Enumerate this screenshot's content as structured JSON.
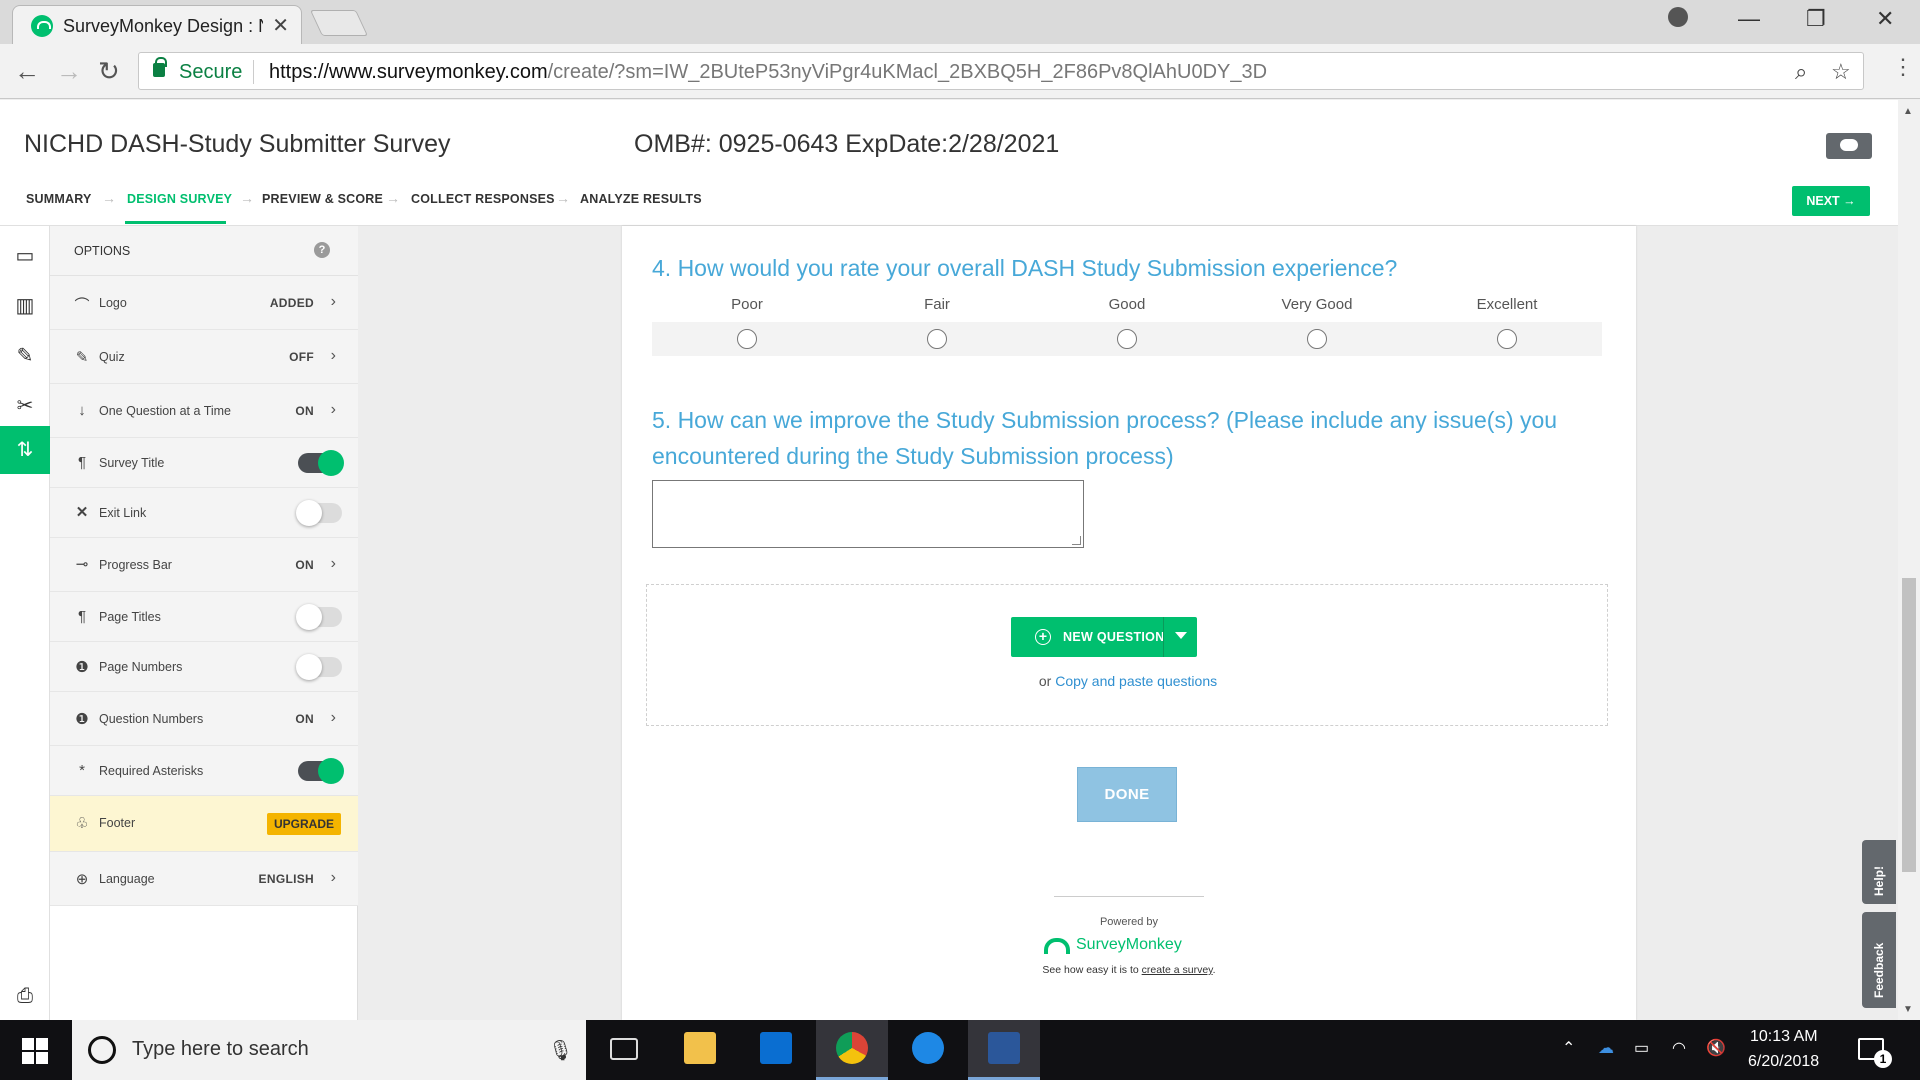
{
  "browser": {
    "tab_title": "SurveyMonkey Design : N",
    "tab_close": "✕",
    "secure_label": "Secure",
    "url_host": "https://www.surveymonkey.com",
    "url_path": "/create/?sm=IW_2BUteP53nyViPgr4uKMacl_2BXBQ5H_2F86Pv8QlAhU0DY_3D"
  },
  "header": {
    "survey_title": "NICHD DASH-Study Submitter Survey",
    "omb": "OMB#: 0925-0643 ExpDate:2/28/2021",
    "steps": [
      "SUMMARY",
      "DESIGN SURVEY",
      "PREVIEW & SCORE",
      "COLLECT RESPONSES",
      "ANALYZE RESULTS"
    ],
    "active_step": "DESIGN SURVEY",
    "next_label": "NEXT →"
  },
  "options": {
    "heading": "OPTIONS",
    "help": "?",
    "rows": [
      {
        "label": "Logo",
        "value": "ADDED",
        "icon": "logo-icon"
      },
      {
        "label": "Quiz",
        "value": "OFF",
        "icon": "quiz-icon"
      },
      {
        "label": "One Question at a Time",
        "value": "ON",
        "icon": "arrow-down-icon"
      },
      {
        "label": "Survey Title",
        "toggle": true,
        "icon": "paragraph-icon"
      },
      {
        "label": "Exit Link",
        "toggle": false,
        "icon": "x-icon"
      },
      {
        "label": "Progress Bar",
        "value": "ON",
        "icon": "progress-icon"
      },
      {
        "label": "Page Titles",
        "toggle": false,
        "icon": "paragraph-icon"
      },
      {
        "label": "Page Numbers",
        "toggle": false,
        "icon": "number-icon"
      },
      {
        "label": "Question Numbers",
        "value": "ON",
        "icon": "number-icon"
      },
      {
        "label": "Required Asterisks",
        "toggle": true,
        "icon": "asterisk-icon"
      },
      {
        "label": "Footer",
        "badge": "UPGRADE",
        "icon": "footprints-icon"
      },
      {
        "label": "Language",
        "value": "ENGLISH",
        "icon": "globe-icon"
      }
    ]
  },
  "survey": {
    "q4_title": "4. How would you rate your overall DASH Study Submission experience?",
    "q4_scale": [
      "Poor",
      "Fair",
      "Good",
      "Very Good",
      "Excellent"
    ],
    "q5_title_line1": "5. How can we improve the Study Submission process? (Please include any issue(s) you",
    "q5_title_line2": "encountered during the Study Submission process)",
    "new_question_label": "NEW QUESTION",
    "or_text": "or ",
    "copy_paste_link": "Copy and paste questions",
    "done_label": "DONE",
    "powered_by": "Powered by",
    "brand": "SurveyMonkey",
    "see_how_prefix": "See how easy it is to ",
    "see_how_link": "create a survey",
    "see_how_suffix": "."
  },
  "side_tabs": {
    "help": "Help!",
    "feedback": "Feedback"
  },
  "taskbar": {
    "search_placeholder": "Type here to search",
    "time": "10:13 AM",
    "date": "6/20/2018",
    "notifications": "1"
  },
  "colors": {
    "accent": "#00bf6f",
    "question": "#47a8d8",
    "done": "#8fc3e2",
    "upgrade": "#f4b400"
  }
}
